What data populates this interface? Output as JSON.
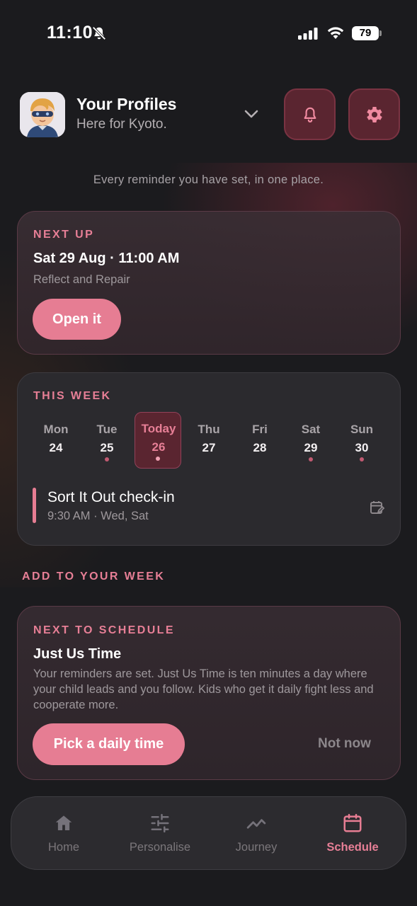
{
  "status_bar": {
    "time": "11:10",
    "battery": "79"
  },
  "header": {
    "title": "Your Profiles",
    "subtitle": "Here for Kyoto."
  },
  "page_subtitle": "Every reminder you have set, in one place.",
  "next_up": {
    "eyebrow": "NEXT UP",
    "datetime": "Sat 29 Aug · 11:00 AM",
    "name": "Reflect and Repair",
    "button": "Open it"
  },
  "this_week": {
    "eyebrow": "THIS WEEK",
    "days": [
      {
        "name": "Mon",
        "num": "24",
        "dot": false
      },
      {
        "name": "Tue",
        "num": "25",
        "dot": true
      },
      {
        "name": "Today",
        "num": "26",
        "dot": true,
        "today": true
      },
      {
        "name": "Thu",
        "num": "27",
        "dot": false
      },
      {
        "name": "Fri",
        "num": "28",
        "dot": false
      },
      {
        "name": "Sat",
        "num": "29",
        "dot": true
      },
      {
        "name": "Sun",
        "num": "30",
        "dot": true
      }
    ],
    "reminder": {
      "title": "Sort It Out check-in",
      "meta": "9:30 AM · Wed, Sat"
    }
  },
  "add_section": {
    "label": "ADD TO YOUR WEEK"
  },
  "next_schedule": {
    "eyebrow": "NEXT TO SCHEDULE",
    "title": "Just Us Time",
    "body": "Your reminders are set. Just Us Time is ten minutes a day where your child leads and you follow. Kids who get it daily fight less and cooperate more.",
    "primary": "Pick a daily time",
    "secondary": "Not now"
  },
  "tabs": [
    {
      "label": "Home",
      "icon": "home-icon"
    },
    {
      "label": "Personalise",
      "icon": "sliders-icon"
    },
    {
      "label": "Journey",
      "icon": "trend-icon"
    },
    {
      "label": "Schedule",
      "icon": "calendar-icon",
      "active": true
    }
  ],
  "colors": {
    "accent": "#e67d93",
    "background": "#1b1b1e",
    "accent_dark": "#5a2530"
  }
}
